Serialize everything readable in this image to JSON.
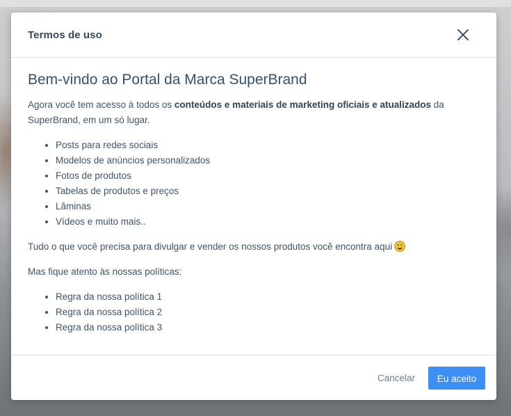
{
  "modal": {
    "title": "Termos de uso",
    "heading": "Bem-vindo ao Portal da Marca SuperBrand",
    "intro_prefix": "Agora você tem acesso à todos os ",
    "intro_bold": "conteúdos e materiais de marketing oficiais e atualizados",
    "intro_suffix": " da SuperBrand, em um só lugar.",
    "features": [
      "Posts para redes sociais",
      "Modelos de anúncios personalizados",
      "Fotos de produtos",
      "Tabelas de produtos e preços",
      "Lâminas",
      "Vídeos e muito mais.."
    ],
    "cta_text": "Tudo o que você precisa para divulgar e vender os nossos produtos você encontra aqui",
    "policies_intro": "Mas fique atento às nossas políticas:",
    "policies": [
      "Regra da nossa política 1",
      "Regra da nossa política 2",
      "Regra da nossa política 3"
    ],
    "cancel_label": "Cancelar",
    "accept_label": "Eu aceito"
  },
  "icons": {
    "close": "close-icon",
    "emoji": "grinning-face-icon"
  },
  "colors": {
    "accent": "#3b8ff5",
    "heading": "#35506e",
    "text": "#3f5468"
  }
}
